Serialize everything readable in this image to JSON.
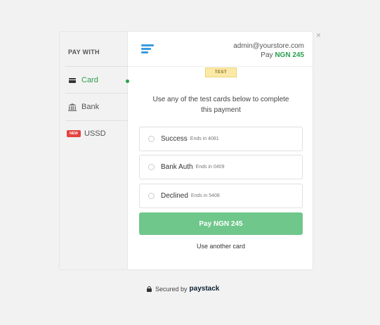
{
  "sidebar": {
    "heading": "PAY WITH",
    "items": [
      {
        "label": "Card",
        "icon": "card-icon",
        "active": true
      },
      {
        "label": "Bank",
        "icon": "bank-icon",
        "active": false
      },
      {
        "label": "USSD",
        "icon": "new-badge",
        "badge": "NEW",
        "active": false
      }
    ]
  },
  "header": {
    "email": "admin@yourstore.com",
    "pay_prefix": "Pay",
    "amount": "NGN 245"
  },
  "test_badge": "TEST",
  "instructions": "Use any of the test cards below to complete this payment",
  "test_cards": [
    {
      "name": "Success",
      "ends": "Ends in 4081"
    },
    {
      "name": "Bank Auth",
      "ends": "Ends in 0409"
    },
    {
      "name": "Declined",
      "ends": "Ends in 5408"
    }
  ],
  "pay_button": "Pay NGN 245",
  "another_card": "Use another card",
  "close": "×",
  "footer": {
    "secured_by": "Secured by",
    "brand": "paystack"
  },
  "colors": {
    "accent_green": "#2b9e4e",
    "button_green": "#6fc78b",
    "logo_blue": "#3b9be0",
    "badge_red": "#e4423f",
    "test_yellow": "#fbe9a8"
  }
}
